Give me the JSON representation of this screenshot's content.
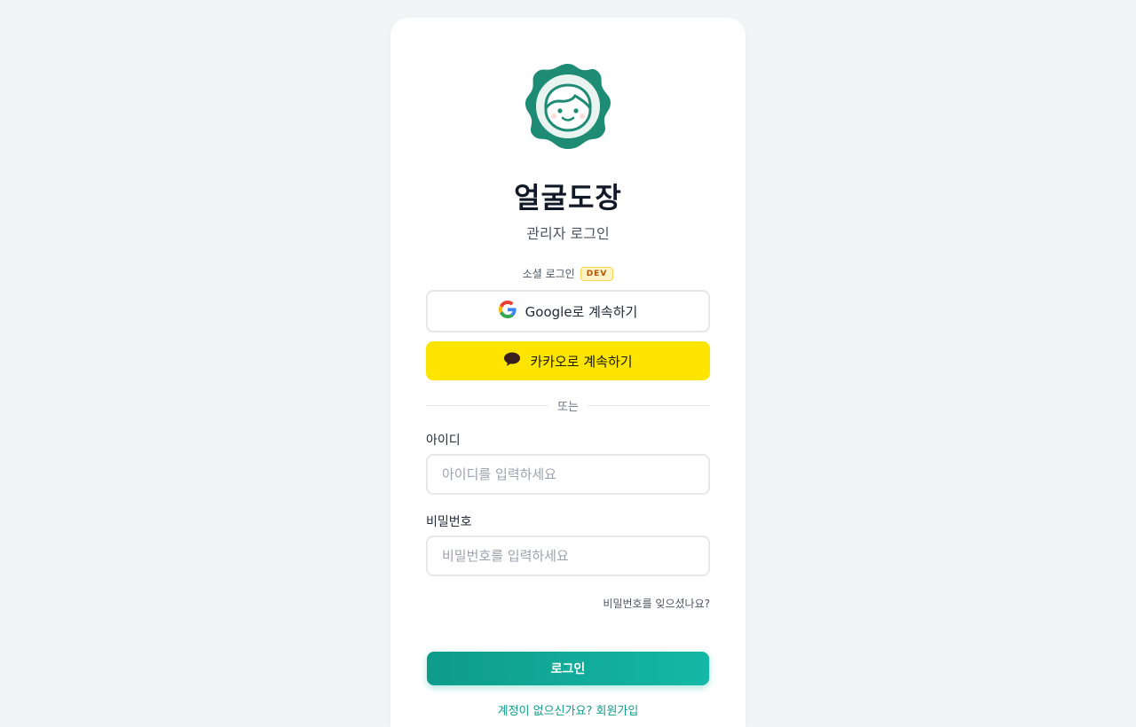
{
  "app": {
    "title": "얼굴도장",
    "subtitle": "관리자 로그인"
  },
  "social": {
    "label": "소셜 로그인",
    "badge": "DEV",
    "google_label": "Google로 계속하기",
    "kakao_label": "카카오로 계속하기"
  },
  "divider": {
    "label": "또는"
  },
  "form": {
    "id_label": "아이디",
    "id_placeholder": "아이디를 입력하세요",
    "password_label": "비밀번호",
    "password_placeholder": "비밀번호를 입력하세요",
    "forgot_label": "비밀번호를 잊으셨나요?",
    "login_label": "로그인",
    "signup_label": "계정이 없으신가요? 회원가입"
  },
  "colors": {
    "brand": "#14b8a6",
    "brand_dark": "#0f9b8a",
    "kakao": "#fee500",
    "background": "#f2f4f6",
    "logo_ring": "#1e8c74"
  },
  "icons": {
    "logo": "face-stamp-logo",
    "google": "google-icon",
    "kakao": "speech-bubble-icon"
  }
}
